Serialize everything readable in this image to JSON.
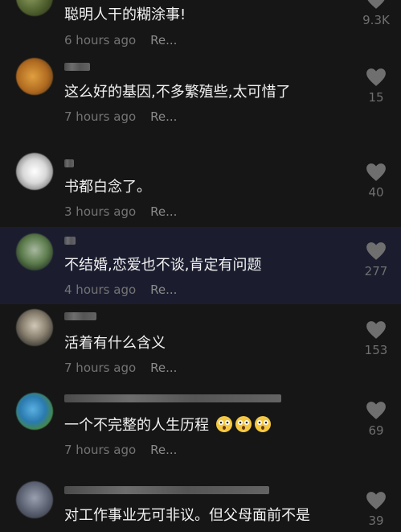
{
  "colors": {
    "background": "#161616",
    "highlight_row": "#1b1d2f",
    "comment_text": "#f2f2f2",
    "meta_text": "#747474",
    "heart_icon": "#6f6f6f"
  },
  "comments": [
    {
      "text": "聪明人干的糊涂事!",
      "time": "6 hours ago",
      "reply": "Re...",
      "likes": "9.3K"
    },
    {
      "text": "这么好的基因,不多繁殖些,太可惜了",
      "time": "7 hours ago",
      "reply": "Re...",
      "likes": "15"
    },
    {
      "text": "书都白念了。",
      "time": "3 hours ago",
      "reply": "Re...",
      "likes": "40"
    },
    {
      "text": "不结婚,恋爱也不谈,肯定有问题",
      "time": "4 hours ago",
      "reply": "Re...",
      "likes": "277"
    },
    {
      "text": "活着有什么含义",
      "time": "7 hours ago",
      "reply": "Re...",
      "likes": "153"
    },
    {
      "text": "一个不完整的人生历程",
      "time": "7 hours ago",
      "reply": "Re...",
      "likes": "69"
    },
    {
      "text": "对工作事业无可非议。但父母面前不是",
      "time": "",
      "reply": "",
      "likes": "39"
    }
  ]
}
